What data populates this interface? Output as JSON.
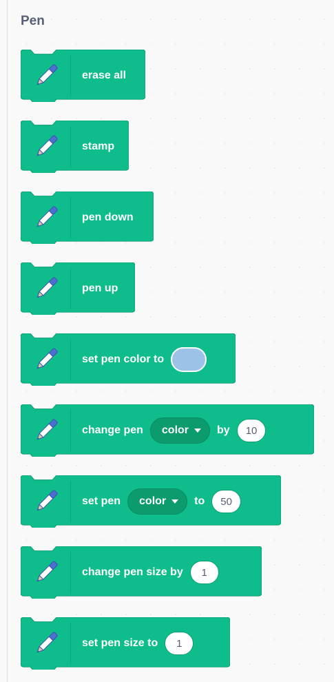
{
  "category": {
    "title": "Pen"
  },
  "colors": {
    "block_fill": "#0fbd8c",
    "block_stroke": "#0b9a70",
    "dropdown_fill": "#0b9b6c",
    "swatch": "#9cc2e8",
    "title_text": "#575e75"
  },
  "blocks": [
    {
      "label": "erase all"
    },
    {
      "label": "stamp"
    },
    {
      "label": "pen down"
    },
    {
      "label": "pen up"
    },
    {
      "label": "set pen color to"
    },
    {
      "label": "change pen",
      "dropdown": "color",
      "mid": "by",
      "value": "10"
    },
    {
      "label": "set pen",
      "dropdown": "color",
      "mid": "to",
      "value": "50"
    },
    {
      "label": "change pen size by",
      "value": "1"
    },
    {
      "label": "set pen size to",
      "value": "1"
    }
  ],
  "icons": {
    "extension": "pen-icon",
    "dropdown_caret": "caret-down-icon"
  }
}
